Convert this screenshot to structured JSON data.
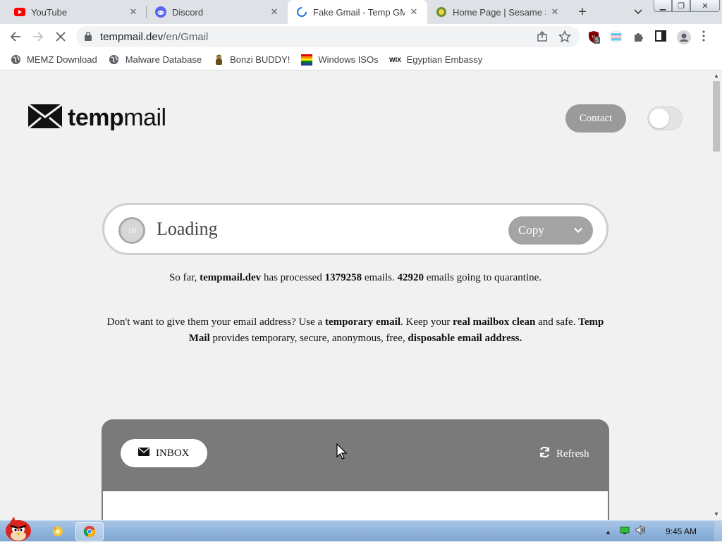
{
  "browser": {
    "tabs": [
      {
        "title": "YouTube",
        "icon": "youtube-icon",
        "active": false
      },
      {
        "title": "Discord",
        "icon": "discord-icon",
        "active": false
      },
      {
        "title": "Fake Gmail - Temp GMail",
        "icon": "loading-spinner-icon",
        "active": true
      },
      {
        "title": "Home Page | Sesame Street",
        "icon": "sesame-street-icon",
        "active": false
      }
    ],
    "url_host": "tempmail.dev",
    "url_path": "/en/Gmail",
    "extension_badge": "5",
    "bookmarks": [
      {
        "label": "MEMZ Download",
        "icon": "globe-icon"
      },
      {
        "label": "Malware Database",
        "icon": "globe-icon"
      },
      {
        "label": "Bonzi BUDDY!",
        "icon": "bonzi-icon"
      },
      {
        "label": "Windows ISOs",
        "icon": "windows-flag-icon"
      },
      {
        "label": "Egyptian Embassy",
        "icon": "wix-icon"
      }
    ]
  },
  "page": {
    "logo_bold": "temp",
    "logo_light": "mail",
    "contact_label": "Contact",
    "theme_toggle_on": false,
    "counter": "10",
    "email_value": "Loading",
    "copy_label": "Copy",
    "stats": {
      "prefix": "So far, ",
      "site": "tempmail.dev",
      "mid1": " has processed ",
      "processed": "1379258",
      "mid2": " emails. ",
      "quarantine": "42920",
      "suffix": " emails going to quarantine."
    },
    "desc": {
      "t1": "Don't want to give them your email address? Use a ",
      "b1": "temporary email",
      "t2": ". Keep your ",
      "b2": "real mailbox clean",
      "t3": " and safe. ",
      "b3": "Temp Mail",
      "t4": " provides temporary, secure, anonymous, free, ",
      "b4": "disposable email address."
    },
    "inbox_label": "INBOX",
    "refresh_label": "Refresh"
  },
  "taskbar": {
    "time": "9:45 AM"
  },
  "colors": {
    "tabstrip": "#dee1e6",
    "page_bg": "#f1f1f1",
    "panel_gray": "#7a7a7a",
    "button_gray": "#a4a4a4"
  }
}
